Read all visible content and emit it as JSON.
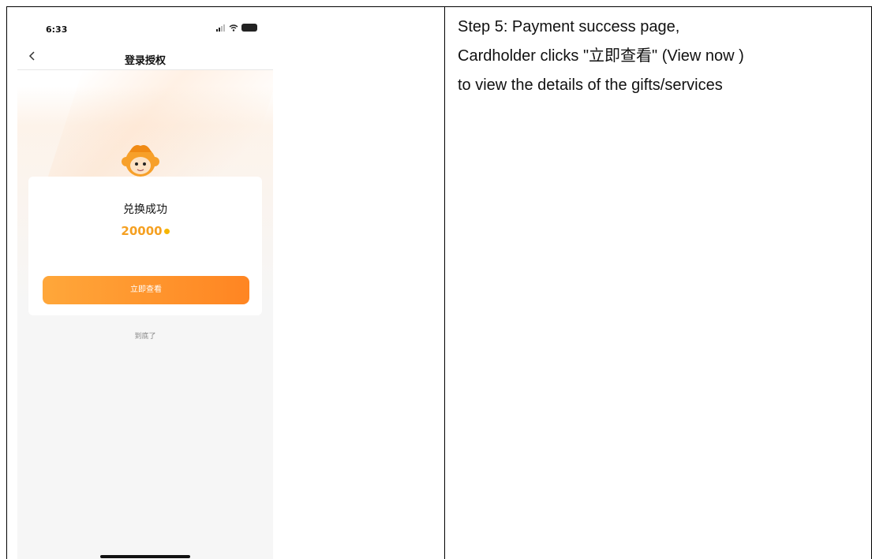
{
  "phone": {
    "status": {
      "time": "6:33"
    },
    "nav": {
      "back_icon": "chevron-left-icon",
      "title": "登录授权"
    },
    "result": {
      "title": "兑换成功",
      "points": "20000",
      "button_label": "立即查看"
    },
    "footer_text": "到底了"
  },
  "description": {
    "lines": [
      "Step 5: Payment success page,",
      "Cardholder clicks \"立即查看\"  (View now )",
      "to view the details of the gifts/services"
    ]
  },
  "colors": {
    "accent": "#ff9a2e",
    "points": "#f5a021"
  }
}
